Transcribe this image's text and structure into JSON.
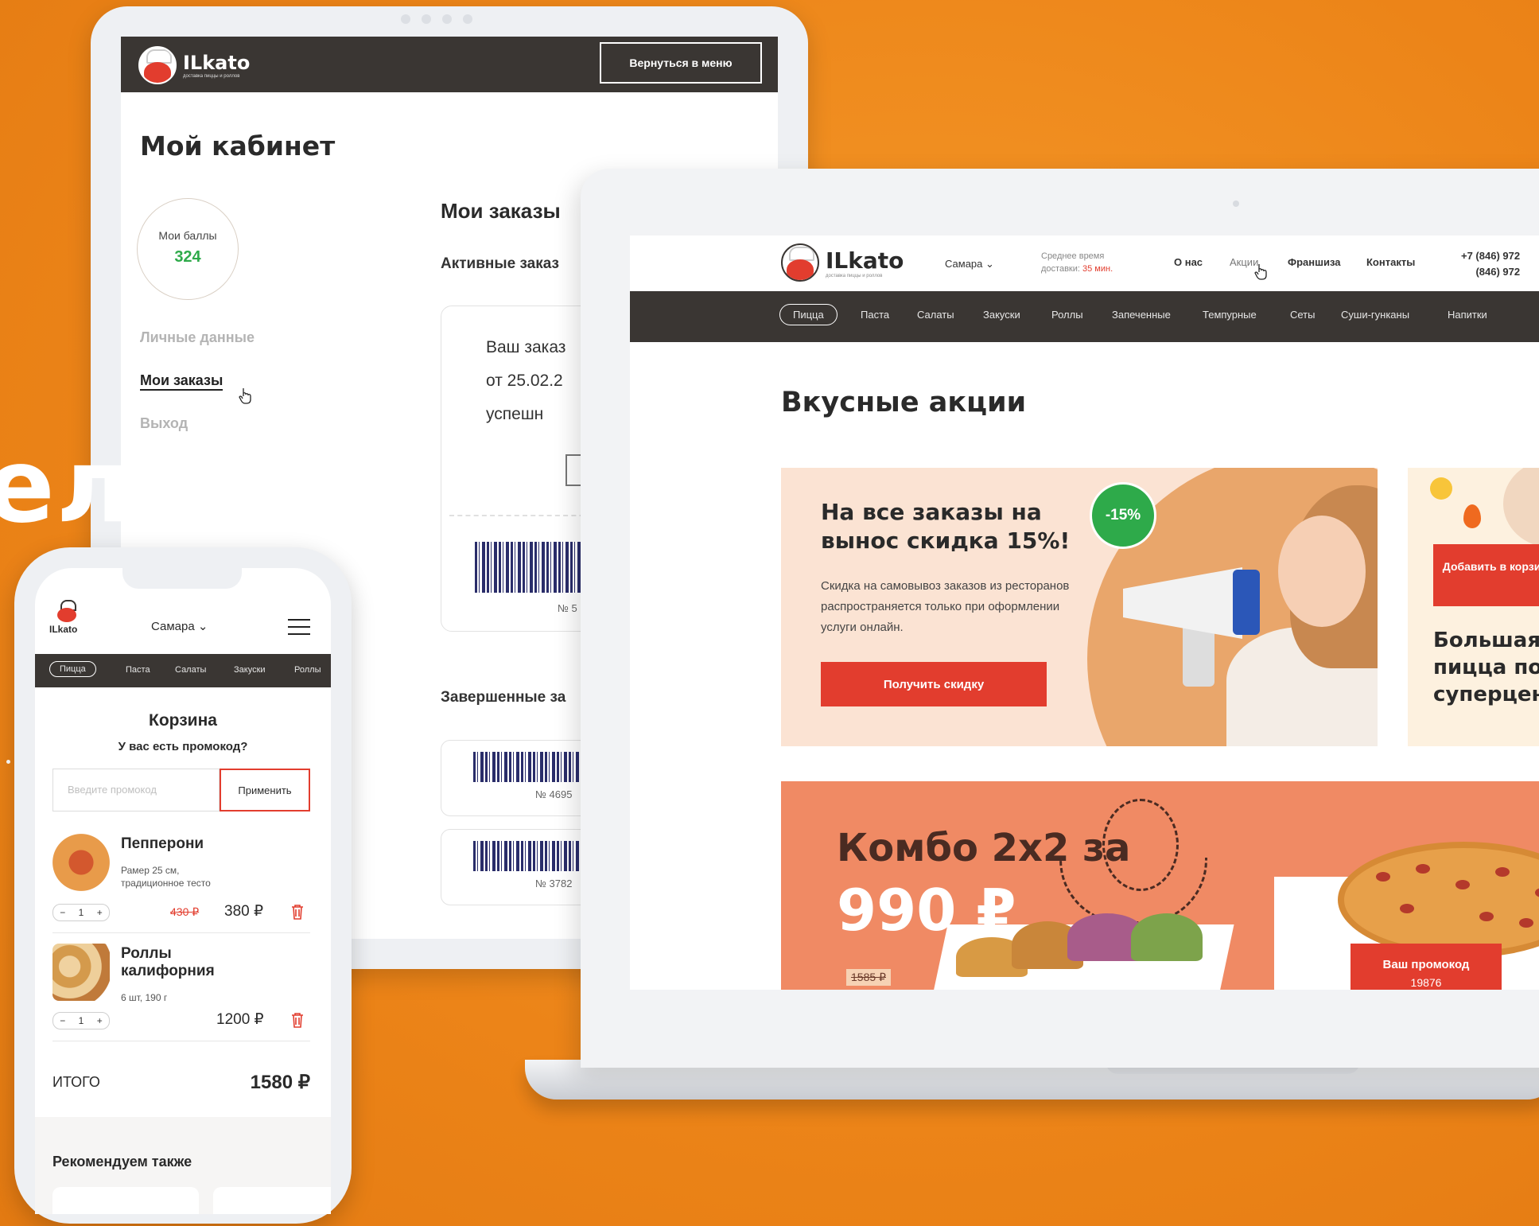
{
  "hero_word": "ельные",
  "tablet": {
    "header": {
      "logo": "ILkato",
      "logo_sub": "доставка пиццы и роллов",
      "back_button": "Вернуться в меню"
    },
    "title": "Мой кабинет",
    "points": {
      "label": "Мои баллы",
      "value": "324"
    },
    "nav": {
      "personal": "Личные данные",
      "orders": "Мои заказы",
      "logout": "Выход"
    },
    "orders_title": "Мои заказы",
    "active_title": "Активные заказ",
    "active_ticket": {
      "line1": "Ваш заказ",
      "line2": "от 25.02.2",
      "line3": "успешн",
      "number": "№ 5"
    },
    "done_title": "Завершенные за",
    "done_tickets": [
      {
        "number": "№ 4695"
      },
      {
        "number": "№ 3782"
      }
    ]
  },
  "laptop": {
    "header": {
      "logo": "ILkato",
      "logo_sub": "доставка пиццы и роллов",
      "city": "Самара",
      "delivery_label_1": "Среднее время",
      "delivery_label_2": "доставки:",
      "delivery_time": "35 мин.",
      "links": [
        "О нас",
        "Акции",
        "Франшиза",
        "Контакты"
      ],
      "phone1": "+7 (846) 972",
      "phone2": "(846) 972"
    },
    "nav": [
      "Пицца",
      "Паста",
      "Салаты",
      "Закуски",
      "Роллы",
      "Запеченные",
      "Темпурные",
      "Сеты",
      "Суши-гунканы",
      "Напитки"
    ],
    "page_title": "Вкусные акции",
    "promo1": {
      "badge": "-15%",
      "title": "На все заказы на вынос скидка 15%!",
      "text": "Скидка на самовывоз заказов из ресторанов распространяется только при оформлении услуги онлайн.",
      "button": "Получить скидку"
    },
    "promo2": {
      "button": "Добавить в корзину!",
      "title_1": "Большая",
      "title_2": "пицца по",
      "title_3": "суперцен"
    },
    "promo3": {
      "title": "Комбо 2х2 за",
      "price": "990 ₽",
      "old_price": "1585 ₽",
      "code_label": "Ваш промокод",
      "code": "19876"
    }
  },
  "phone": {
    "logo": "ILkato",
    "city": "Самара",
    "nav": [
      "Пицца",
      "Паста",
      "Салаты",
      "Закуски",
      "Роллы"
    ],
    "cart_title": "Корзина",
    "promo_question": "У вас есть промокод?",
    "promo_placeholder": "Введите промокод",
    "apply": "Применить",
    "items": [
      {
        "name_1": "Пепперони",
        "name_2": "",
        "desc_1": "Рамер 25 см,",
        "desc_2": "традиционное тесто",
        "qty": "1",
        "old_price": "430 ₽",
        "price": "380 ₽"
      },
      {
        "name_1": "Роллы",
        "name_2": "калифорния",
        "desc_1": "6 шт, 190 г",
        "desc_2": "",
        "qty": "1",
        "old_price": "",
        "price": "1200 ₽"
      }
    ],
    "total_label": "ИТОГО",
    "total_value": "1580 ₽",
    "recommend": "Рекомендуем также"
  },
  "colors": {
    "orange_bg": "#f08a1c",
    "dark": "#3a3633",
    "red": "#e23d2e",
    "green": "#2eaa4a"
  }
}
